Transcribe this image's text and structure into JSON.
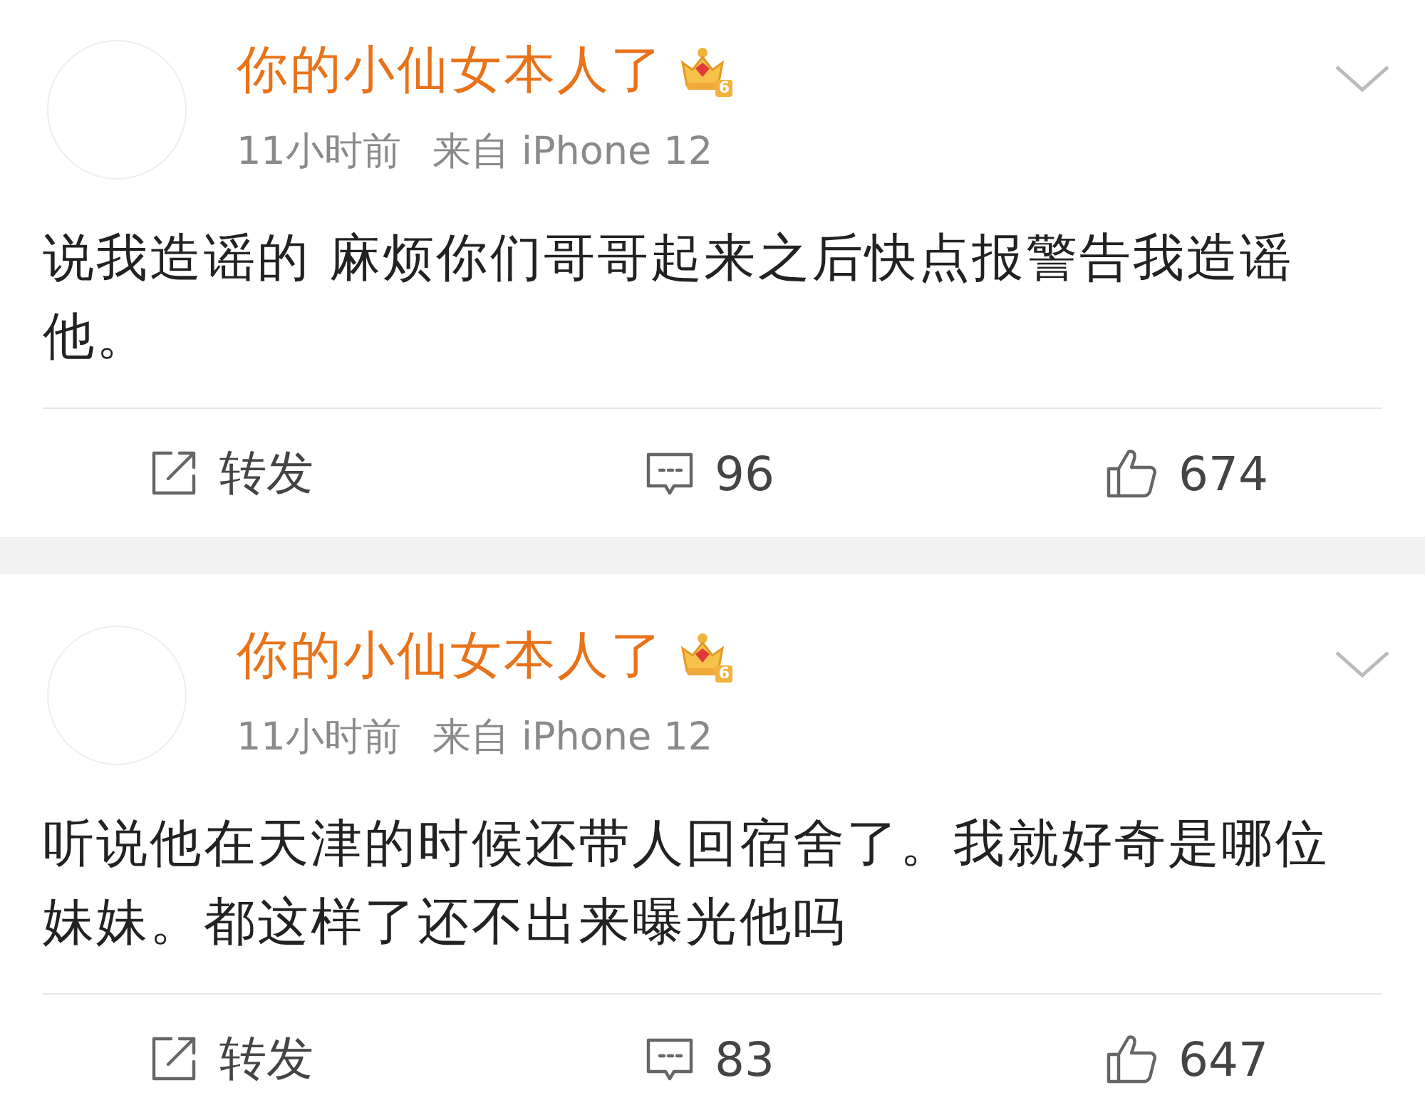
{
  "posts": [
    {
      "author": "你的小仙女本人了",
      "badge_level": "6",
      "time": "11小时前",
      "source": "来自 iPhone 12",
      "text": "说我造谣的 麻烦你们哥哥起来之后快点报警告我造谣他。",
      "actions": {
        "repost": "转发",
        "comments": "96",
        "likes": "674"
      }
    },
    {
      "author": "你的小仙女本人了",
      "badge_level": "6",
      "time": "11小时前",
      "source": "来自 iPhone 12",
      "text": "听说他在天津的时候还带人回宿舍了。我就好奇是哪位妹妹。都这样了还不出来曝光他吗",
      "actions": {
        "repost": "转发",
        "comments": "83",
        "likes": "647"
      }
    }
  ]
}
